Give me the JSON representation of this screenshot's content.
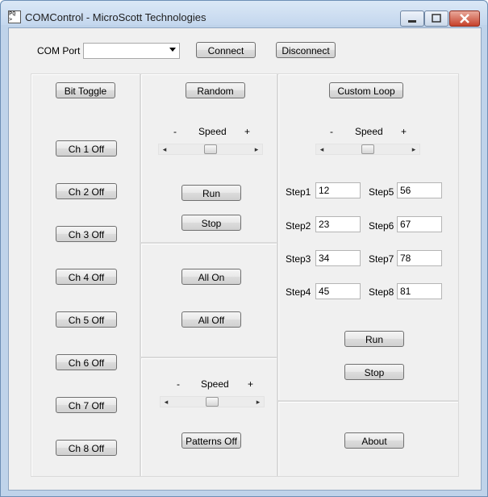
{
  "window": {
    "title": "COMControl - MicroScott Technologies",
    "icon_text": "PQ\n>"
  },
  "top": {
    "com_port_label": "COM Port",
    "com_port_value": "",
    "connect": "Connect",
    "disconnect": "Disconnect"
  },
  "bit_toggle": {
    "header": "Bit Toggle",
    "channels": [
      "Ch 1 Off",
      "Ch 2 Off",
      "Ch 3 Off",
      "Ch 4 Off",
      "Ch 5 Off",
      "Ch 6 Off",
      "Ch 7 Off",
      "Ch 8 Off"
    ]
  },
  "random": {
    "header": "Random",
    "minus": "-",
    "speed": "Speed",
    "plus": "+",
    "run": "Run",
    "stop": "Stop"
  },
  "all": {
    "on": "All On",
    "off": "All Off"
  },
  "patterns": {
    "minus": "-",
    "speed": "Speed",
    "plus": "+",
    "button": "Patterns Off"
  },
  "custom_loop": {
    "header": "Custom Loop",
    "minus": "-",
    "speed": "Speed",
    "plus": "+",
    "steps": [
      {
        "label": "Step1",
        "value": "12"
      },
      {
        "label": "Step2",
        "value": "23"
      },
      {
        "label": "Step3",
        "value": "34"
      },
      {
        "label": "Step4",
        "value": "45"
      },
      {
        "label": "Step5",
        "value": "56"
      },
      {
        "label": "Step6",
        "value": "67"
      },
      {
        "label": "Step7",
        "value": "78"
      },
      {
        "label": "Step8",
        "value": "81"
      }
    ],
    "run": "Run",
    "stop": "Stop"
  },
  "about": "About",
  "sliders": {
    "random_level": 0.5,
    "patterns_level": 0.5,
    "custom_level": 0.5
  }
}
